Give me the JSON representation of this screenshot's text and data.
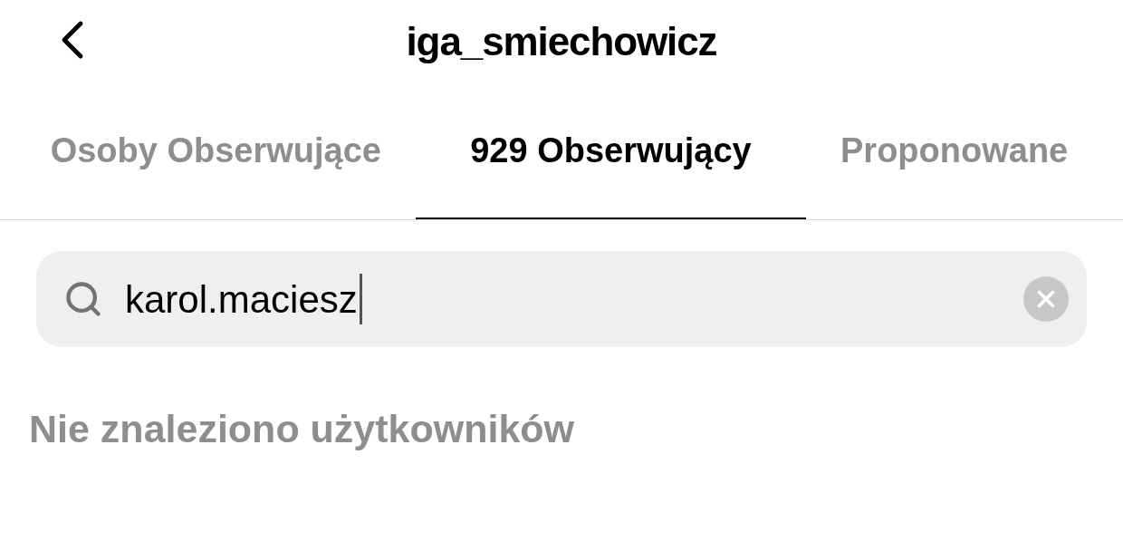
{
  "header": {
    "title": "iga_smiechowicz"
  },
  "tabs": [
    {
      "label": "Osoby Obserwujące",
      "selected": false
    },
    {
      "label": "929 Obserwujący",
      "selected": true
    },
    {
      "label": "Proponowane",
      "selected": false
    }
  ],
  "search": {
    "value": "karol.maciesz"
  },
  "empty_message": "Nie znaleziono użytkowników"
}
